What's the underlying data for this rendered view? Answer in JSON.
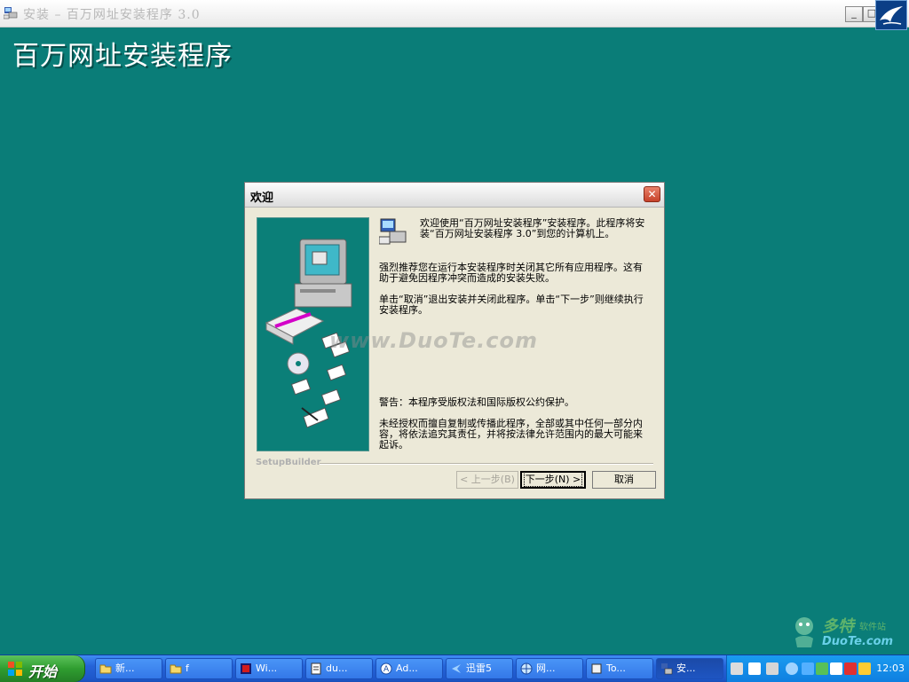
{
  "window": {
    "title": "安装 – 百万网址安装程序 3.0",
    "minimize_label": "_",
    "maximize_label": "□",
    "big_title": "百万网址安装程序"
  },
  "dialog": {
    "title": "欢迎",
    "close_label": "✕",
    "p1": "欢迎使用“百万网址安装程序”安装程序。此程序将安装“百万网址安装程序 3.0”到您的计算机上。",
    "p2": "强烈推荐您在运行本安装程序时关闭其它所有应用程序。这有助于避免因程序冲突而造成的安装失败。",
    "p3": "单击“取消”退出安装并关闭此程序。单击“下一步”则继续执行安装程序。",
    "p4": "警告：本程序受版权法和国际版权公约保护。",
    "p5": "未经授权而擅自复制或传播此程序，全部或其中任何一部分内容，将依法追究其责任，并将按法律允许范围内的最大可能来起诉。",
    "watermark": "www.DuoTe.com",
    "setupbuilder": "SetupBuilder",
    "back_label": "< 上一步(B)",
    "next_label": "下一步(N) >",
    "cancel_label": "取消"
  },
  "site_logo": {
    "name": "多特",
    "sub": "软件站",
    "url": "DuoTe.com"
  },
  "taskbar": {
    "start_label": "开始",
    "tasks": [
      {
        "label": "新..."
      },
      {
        "label": "f"
      },
      {
        "label": "Wi..."
      },
      {
        "label": "du..."
      },
      {
        "label": "Ad..."
      },
      {
        "label": "迅雷5"
      },
      {
        "label": "网..."
      },
      {
        "label": "To..."
      },
      {
        "label": "安..."
      }
    ],
    "clock": "12:03"
  },
  "colors": {
    "desktop": "#0a7d78",
    "taskbar": "#245edb",
    "start": "#36a337"
  }
}
